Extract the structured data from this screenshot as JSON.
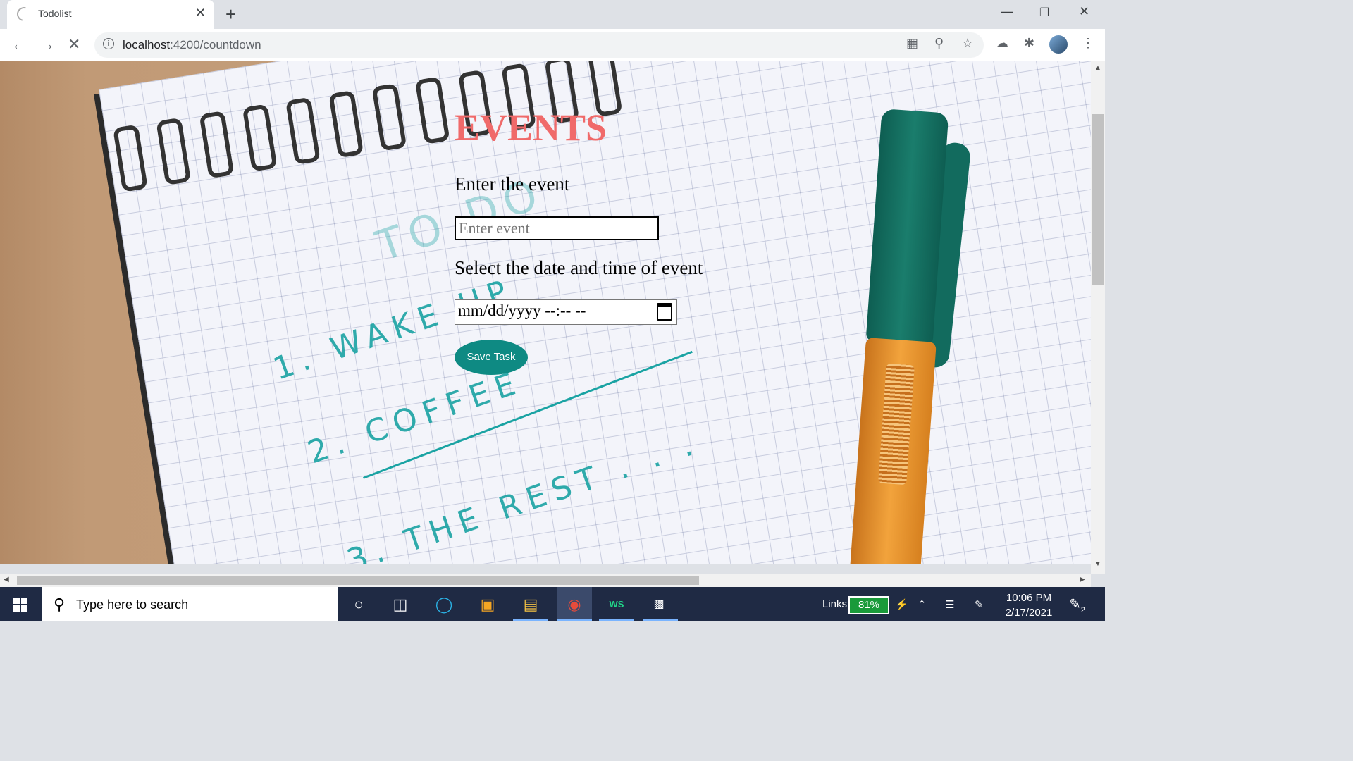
{
  "browser": {
    "tab_title": "Todolist",
    "tab_close": "✕",
    "new_tab": "+",
    "url_host": "localhost",
    "url_path": ":4200/countdown"
  },
  "page": {
    "heading": "EVENTS",
    "event_label": "Enter the event",
    "event_placeholder": "Enter event",
    "event_value": "",
    "datetime_label": "Select the date and time of event",
    "datetime_value": "mm/dd/yyyy --:-- --",
    "save_button": "Save Task"
  },
  "background_notes": {
    "item1": "1. WAKE UP",
    "item2": "2. COFFEE",
    "item3": "3. THE REST . . .",
    "title": "TO DO"
  },
  "taskbar": {
    "search_placeholder": "Type here to search",
    "links_label": "Links",
    "battery": "81%",
    "time": "10:06 PM",
    "date": "2/17/2021",
    "notifications": "2"
  },
  "colors": {
    "heading": "#f06a6a",
    "save_button": "#0e8a83",
    "taskbar": "#1f2a44"
  }
}
